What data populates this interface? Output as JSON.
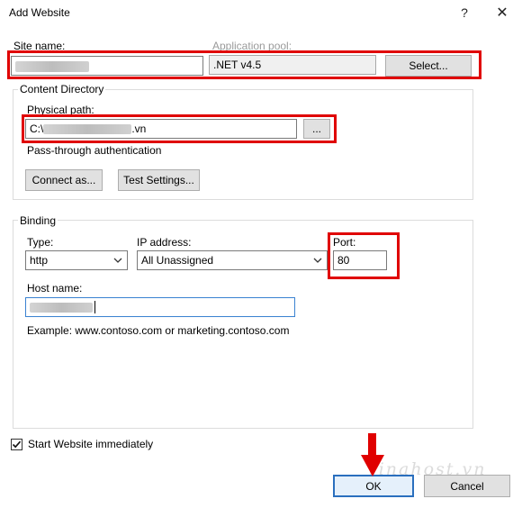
{
  "window": {
    "title": "Add Website",
    "help_glyph": "?",
    "close_glyph": "✕"
  },
  "site": {
    "site_name_label": "Site name:",
    "app_pool_label": "Application pool:",
    "app_pool_value": ".NET v4.5",
    "select_button": "Select..."
  },
  "content_directory": {
    "group_label": "Content Directory",
    "physical_path_label": "Physical path:",
    "physical_path_prefix": "C:\\",
    "physical_path_suffix": ".vn",
    "browse_button": "...",
    "pass_through_label": "Pass-through authentication",
    "connect_as_button": "Connect as...",
    "test_settings_button": "Test Settings..."
  },
  "binding": {
    "group_label": "Binding",
    "type_label": "Type:",
    "type_value": "http",
    "ip_label": "IP address:",
    "ip_value": "All Unassigned",
    "port_label": "Port:",
    "port_value": "80",
    "host_name_label": "Host name:",
    "example_text": "Example: www.contoso.com or marketing.contoso.com"
  },
  "start_immediately": {
    "label": "Start Website immediately",
    "checked": true
  },
  "footer": {
    "ok_button": "OK",
    "cancel_button": "Cancel",
    "watermark": "vinahost.vn"
  },
  "colors": {
    "highlight": "#e00000",
    "focus_blue": "#2a6fbe"
  }
}
